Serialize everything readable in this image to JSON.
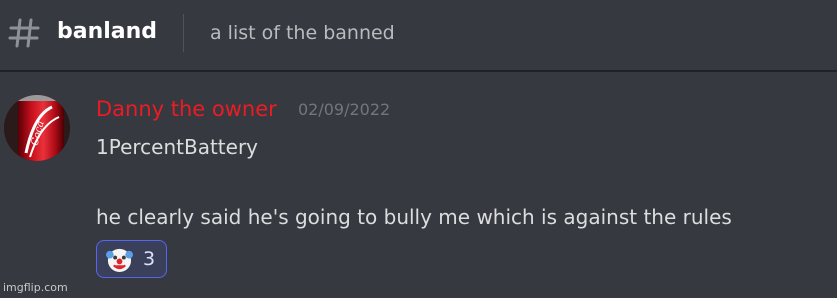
{
  "header": {
    "channel_icon": "hashtag-icon",
    "channel_name": "banland",
    "topic": "a list of the banned"
  },
  "message": {
    "avatar_icon": "coca-cola-can-avatar",
    "username": "Danny the owner",
    "username_color": "#ed1b24",
    "timestamp": "02/09/2022",
    "lines": [
      "1PercentBattery",
      "he clearly said he's going to bully me which is against the rules"
    ],
    "reaction": {
      "emoji": "clown-face-icon",
      "count": "3"
    }
  },
  "watermark": "imgflip.com",
  "colors": {
    "background": "#36393f",
    "reaction_border": "#5865f2",
    "reaction_bg": "#3b405a"
  }
}
